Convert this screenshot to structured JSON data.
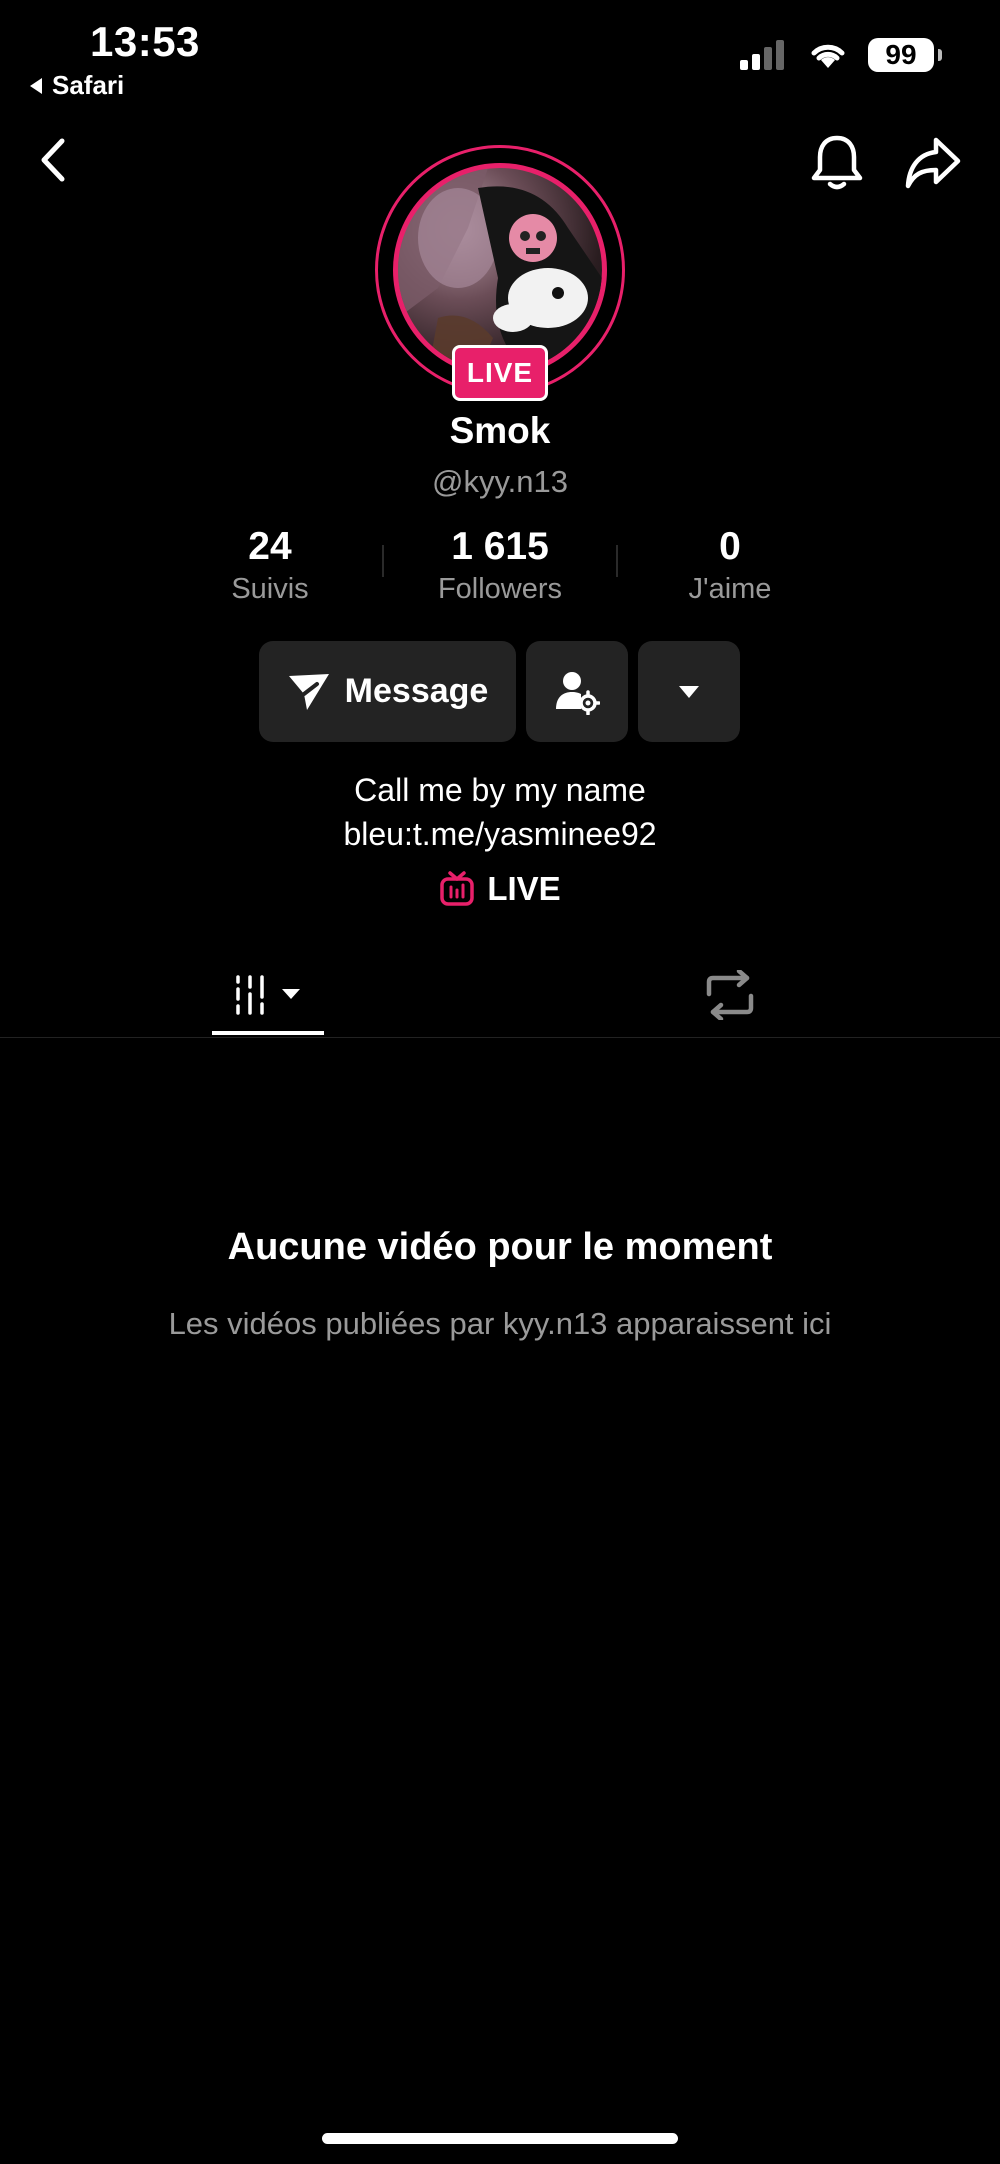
{
  "status_bar": {
    "time": "13:53",
    "back_app": "Safari",
    "battery": "99"
  },
  "profile": {
    "live_badge": "LIVE",
    "display_name": "Smok",
    "handle": "@kyy.n13",
    "stats": [
      {
        "value": "24",
        "label": "Suivis"
      },
      {
        "value": "1 615",
        "label": "Followers"
      },
      {
        "value": "0",
        "label": "J'aime"
      }
    ],
    "message_button": "Message",
    "bio_line1": "Call me by my name",
    "bio_line2": "bleu:t.me/yasminee92",
    "live_link": "LIVE"
  },
  "empty_state": {
    "title": "Aucune vidéo pour le moment",
    "subtitle": "Les vidéos publiées par kyy.n13 apparaissent ici"
  },
  "colors": {
    "accent": "#e8206a",
    "background": "#000000",
    "button_bg": "#232323",
    "muted_text": "#9a9a9a"
  },
  "icons": [
    "back-icon",
    "bell-icon",
    "share-icon",
    "send-icon",
    "user-settings-icon",
    "chevron-down-icon",
    "tv-live-icon",
    "grid-icon",
    "repost-icon"
  ]
}
